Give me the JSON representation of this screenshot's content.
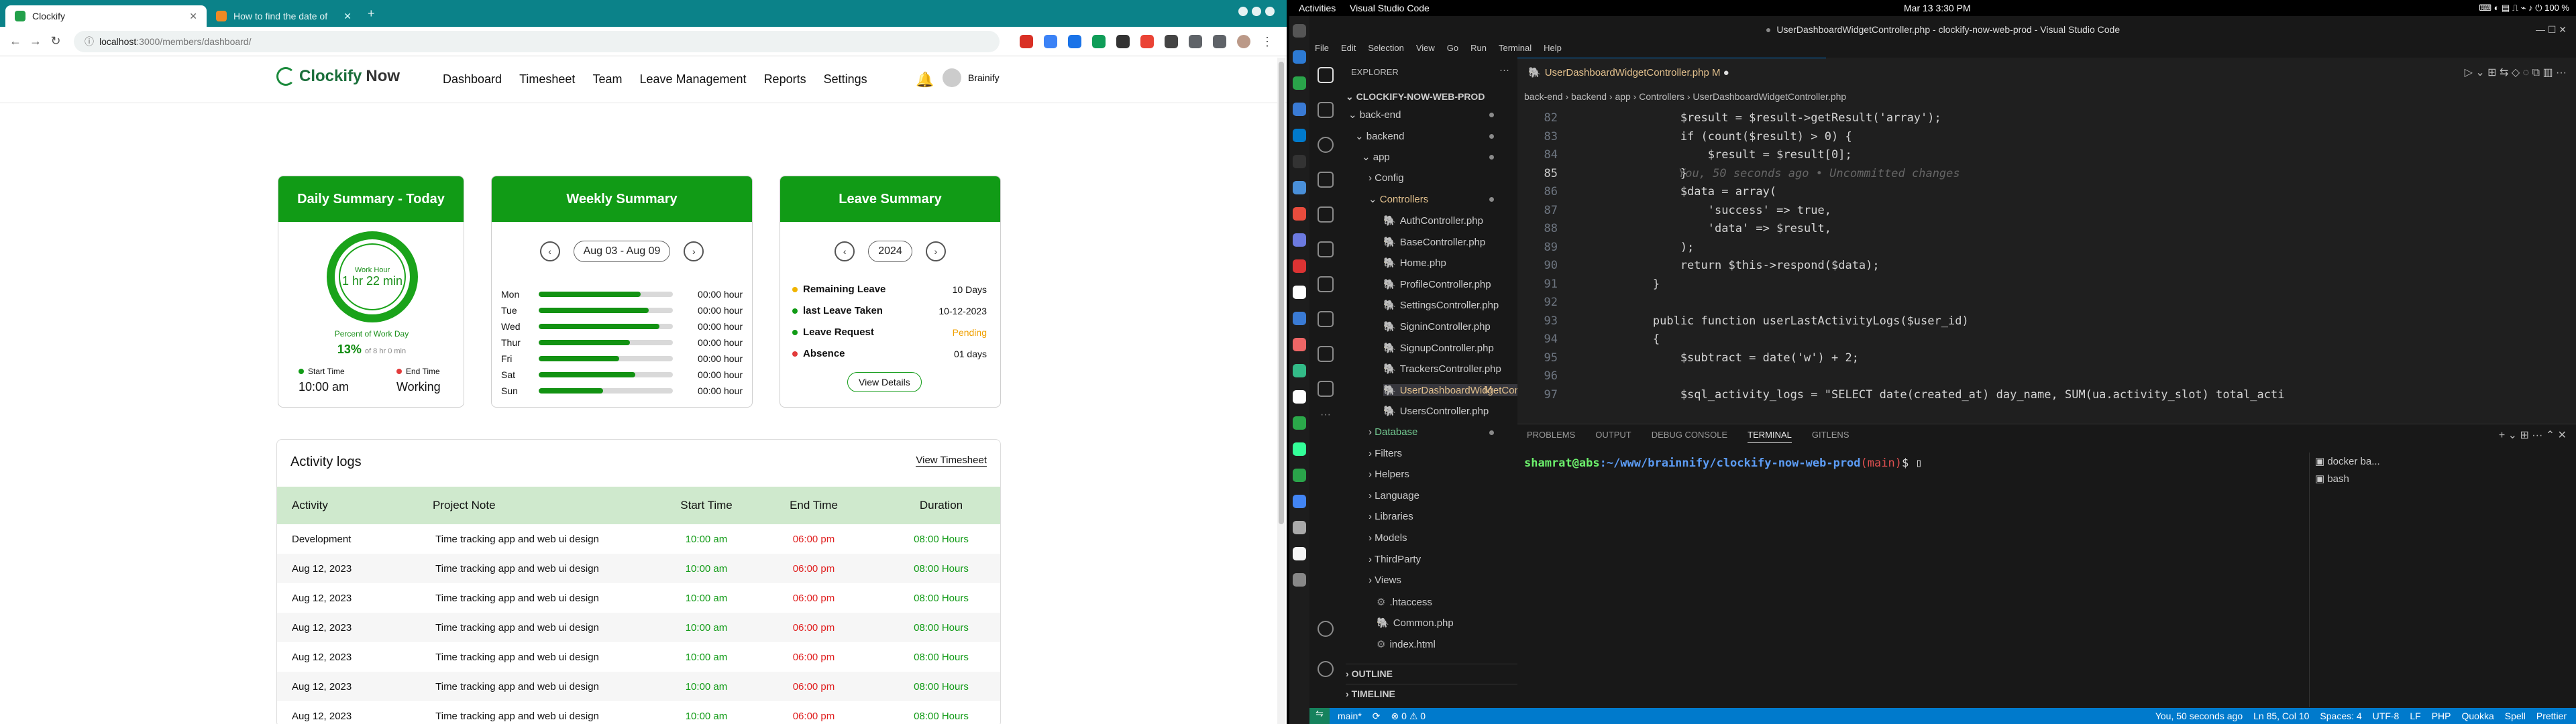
{
  "browser": {
    "tabs": [
      {
        "title": "Clockify"
      },
      {
        "title": "How to find the date of"
      }
    ],
    "url_host": "localhost",
    "url_path": ":3000/members/dashboard/"
  },
  "app": {
    "logo_prefix": "Clockify",
    "logo_suffix": "Now",
    "nav": [
      "Dashboard",
      "Timesheet",
      "Team",
      "Leave Management",
      "Reports",
      "Settings"
    ],
    "user_name": "Brainify"
  },
  "daily": {
    "title": "Daily Summary - Today",
    "gauge_label": "Work Hour",
    "gauge_value": "1 hr 22 min",
    "percent_label": "Percent of Work Day",
    "percent_value": "13%",
    "percent_of": "of 8 hr 0 min",
    "start_label": "Start Time",
    "start_value": "10:00 am",
    "end_label": "End Time",
    "end_value": "Working",
    "start_color": "#119b16",
    "end_color": "#e23b3b"
  },
  "weekly": {
    "title": "Weekly Summary",
    "range": "Aug 03 - Aug 09",
    "days": [
      {
        "day": "Mon",
        "hours": "00:00 hour",
        "fill": 0.76
      },
      {
        "day": "Tue",
        "hours": "00:00 hour",
        "fill": 0.82
      },
      {
        "day": "Wed",
        "hours": "00:00 hour",
        "fill": 0.9
      },
      {
        "day": "Thur",
        "hours": "00:00 hour",
        "fill": 0.68
      },
      {
        "day": "Fri",
        "hours": "00:00 hour",
        "fill": 0.6
      },
      {
        "day": "Sat",
        "hours": "00:00 hour",
        "fill": 0.72
      },
      {
        "day": "Sun",
        "hours": "00:00 hour",
        "fill": 0.48
      }
    ]
  },
  "leave": {
    "title": "Leave Summary",
    "year": "2024",
    "rows": [
      {
        "label": "Remaining Leave",
        "value": "10 Days",
        "color": "#f0b400",
        "value_color": "#111111"
      },
      {
        "label": "last Leave Taken",
        "value": "10-12-2023",
        "color": "#119b16",
        "value_color": "#111111"
      },
      {
        "label": "Leave Request",
        "value": "Pending",
        "color": "#119b16",
        "value_color": "#f0a000"
      },
      {
        "label": "Absence",
        "value": "01 days",
        "color": "#e23b3b",
        "value_color": "#111111"
      }
    ],
    "button": "View Details"
  },
  "activity": {
    "title": "Activity logs",
    "button": "View Timesheet",
    "columns": [
      "Activity",
      "Project Note",
      "Start Time",
      "End Time",
      "Duration"
    ],
    "rows": [
      {
        "activity": "Development",
        "note": "Time tracking app and web ui design",
        "start": "10:00 am",
        "end": "06:00 pm",
        "duration": "08:00 Hours"
      },
      {
        "activity": "Aug 12, 2023",
        "note": "Time tracking app and web ui design",
        "start": "10:00 am",
        "end": "06:00 pm",
        "duration": "08:00 Hours"
      },
      {
        "activity": "Aug 12, 2023",
        "note": "Time tracking app and web ui design",
        "start": "10:00 am",
        "end": "06:00 pm",
        "duration": "08:00 Hours"
      },
      {
        "activity": "Aug 12, 2023",
        "note": "Time tracking app and web ui design",
        "start": "10:00 am",
        "end": "06:00 pm",
        "duration": "08:00 Hours"
      },
      {
        "activity": "Aug 12, 2023",
        "note": "Time tracking app and web ui design",
        "start": "10:00 am",
        "end": "06:00 pm",
        "duration": "08:00 Hours"
      },
      {
        "activity": "Aug 12, 2023",
        "note": "Time tracking app and web ui design",
        "start": "10:00 am",
        "end": "06:00 pm",
        "duration": "08:00 Hours"
      },
      {
        "activity": "Aug 12, 2023",
        "note": "Time tracking app and web ui design",
        "start": "10:00 am",
        "end": "06:00 pm",
        "duration": "08:00 Hours"
      }
    ]
  },
  "gnome": {
    "activities": "Activities",
    "app": "Visual Studio Code",
    "clock": "Mar 13  3:30 PM",
    "battery": "100 %"
  },
  "vscode": {
    "title": "UserDashboardWidgetController.php - clockify-now-web-prod - Visual Studio Code",
    "menu": [
      "File",
      "Edit",
      "Selection",
      "View",
      "Go",
      "Run",
      "Terminal",
      "Help"
    ],
    "explorer_title": "EXPLORER",
    "project": "CLOCKIFY-NOW-WEB-PROD",
    "tree": [
      {
        "name": "back-end",
        "indent": 1,
        "arrow": "⌄",
        "dot": true
      },
      {
        "name": "backend",
        "indent": 2,
        "arrow": "⌄",
        "dot": true
      },
      {
        "name": "app",
        "indent": 3,
        "arrow": "⌄",
        "dot": true
      },
      {
        "name": "Config",
        "indent": 4,
        "arrow": "›",
        "dot": false
      },
      {
        "name": "Controllers",
        "indent": 4,
        "arrow": "⌄",
        "dot": true,
        "color": "#e2c08d"
      },
      {
        "name": "AuthController.php",
        "indent": 5,
        "php": true
      },
      {
        "name": "BaseController.php",
        "indent": 5,
        "php": true
      },
      {
        "name": "Home.php",
        "indent": 5,
        "php": true
      },
      {
        "name": "ProfileController.php",
        "indent": 5,
        "php": true
      },
      {
        "name": "SettingsController.php",
        "indent": 5,
        "php": true
      },
      {
        "name": "SigninController.php",
        "indent": 5,
        "php": true
      },
      {
        "name": "SignupController.php",
        "indent": 5,
        "php": true
      },
      {
        "name": "TrackersController.php",
        "indent": 5,
        "php": true
      },
      {
        "name": "UserDashboardWidgetController.php",
        "indent": 5,
        "php": true,
        "selected": true,
        "color": "#e2c08d",
        "badge": "M"
      },
      {
        "name": "UsersController.php",
        "indent": 5,
        "php": true
      },
      {
        "name": "Database",
        "indent": 4,
        "arrow": "›",
        "dot": true,
        "color": "#73c991"
      },
      {
        "name": "Filters",
        "indent": 4,
        "arrow": "›"
      },
      {
        "name": "Helpers",
        "indent": 4,
        "arrow": "›"
      },
      {
        "name": "Language",
        "indent": 4,
        "arrow": "›"
      },
      {
        "name": "Libraries",
        "indent": 4,
        "arrow": "›"
      },
      {
        "name": "Models",
        "indent": 4,
        "arrow": "›"
      },
      {
        "name": "ThirdParty",
        "indent": 4,
        "arrow": "›"
      },
      {
        "name": "Views",
        "indent": 4,
        "arrow": "›"
      },
      {
        "name": ".htaccess",
        "indent": 4,
        "cfg": true
      },
      {
        "name": "Common.php",
        "indent": 4,
        "php": true
      },
      {
        "name": "index.html",
        "indent": 4,
        "cfg": true
      }
    ],
    "outline": "OUTLINE",
    "timeline": "TIMELINE",
    "tab": "UserDashboardWidgetController.php",
    "tab_badge": "M",
    "breadcrumb": [
      "back-end",
      "backend",
      "app",
      "Controllers",
      "UserDashboardWidgetController.php"
    ],
    "lines": [
      {
        "n": "82",
        "t": "            $result = $result->getResult('array');"
      },
      {
        "n": "83",
        "t": "            if (count($result) > 0) {"
      },
      {
        "n": "84",
        "t": "                $result = $result[0];"
      },
      {
        "n": "85",
        "t": "            }",
        "hint": "You, 50 seconds ago • Uncommitted changes"
      },
      {
        "n": "86",
        "t": "            $data = array("
      },
      {
        "n": "87",
        "t": "                'success' => true,"
      },
      {
        "n": "88",
        "t": "                'data' => $result,"
      },
      {
        "n": "89",
        "t": "            );"
      },
      {
        "n": "90",
        "t": "            return $this->respond($data);"
      },
      {
        "n": "91",
        "t": "        }"
      },
      {
        "n": "92",
        "t": ""
      },
      {
        "n": "93",
        "t": "        public function userLastActivityLogs($user_id)"
      },
      {
        "n": "94",
        "t": "        {"
      },
      {
        "n": "95",
        "t": "            $subtract = date('w') + 2;"
      },
      {
        "n": "96",
        "t": ""
      },
      {
        "n": "97",
        "t": "            $sql_activity_logs = \"SELECT date(created_at) day_name, SUM(ua.activity_slot) total_acti"
      }
    ],
    "panel_tabs": [
      "PROBLEMS",
      "OUTPUT",
      "DEBUG CONSOLE",
      "TERMINAL",
      "GITLENS"
    ],
    "prompt_user": "shamrat@abs",
    "prompt_path": ":~/www/brainnify/clockify-now-web-prod",
    "prompt_branch": "(main)",
    "terminals": [
      "docker ba...",
      "bash"
    ],
    "status_left": [
      "main*",
      "⊗ 0 ⚠ 0"
    ],
    "status_right": [
      "You, 50 seconds ago",
      "Ln 85, Col 10",
      "Spaces: 4",
      "UTF-8",
      "LF",
      "PHP",
      "Quokka",
      "Spell",
      "Prettier"
    ]
  }
}
